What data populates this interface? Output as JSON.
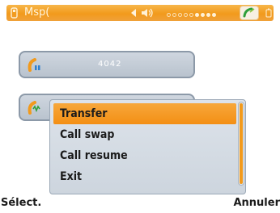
{
  "status_bar": {
    "title": "Msp(",
    "signal_level": 4,
    "signal_max": 9
  },
  "calls": [
    {
      "number": "4042"
    },
    {
      "number": ""
    }
  ],
  "menu": {
    "items": [
      {
        "label": "Transfer",
        "selected": true
      },
      {
        "label": "Call swap",
        "selected": false
      },
      {
        "label": "Call resume",
        "selected": false
      },
      {
        "label": "Exit",
        "selected": false
      }
    ]
  },
  "softkeys": {
    "left": "Sélect.",
    "right": "Annuler"
  },
  "colors": {
    "accent": "#f29a1c",
    "card": "#c3ccd6",
    "popup": "#d5dce4"
  },
  "icons": {
    "status_left": "phone-handset-icon",
    "status_volume": "speaker-icon",
    "status_call": "active-call-icon",
    "status_battery": "battery-icon",
    "call_one": "held-call-icon",
    "call_two": "active-call-icon"
  }
}
